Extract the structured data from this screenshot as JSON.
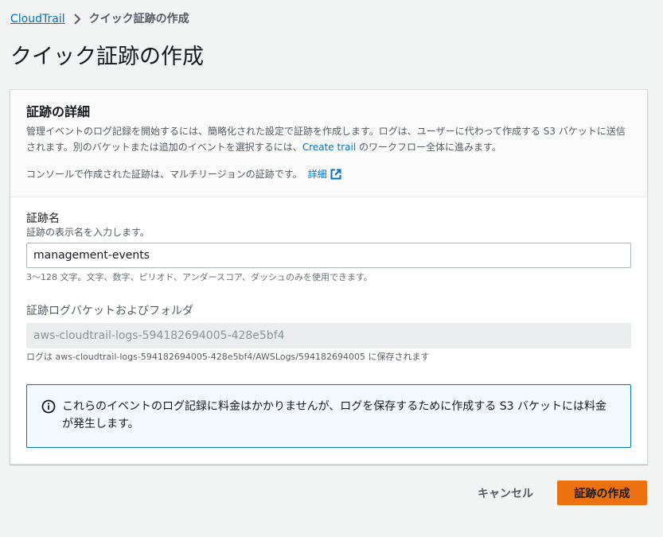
{
  "breadcrumb": {
    "root": "CloudTrail",
    "current": "クイック証跡の作成"
  },
  "page_title": "クイック証跡の作成",
  "details": {
    "heading": "証跡の詳細",
    "description_prefix": "管理イベントのログ記録を開始するには、簡略化された設定で証跡を作成します。ログは、ユーザーに代わって作成する S3 バケットに送信されます。別のバケットまたは追加のイベントを選択するには、",
    "create_trail_link": "Create trail",
    "description_suffix": " のワークフロー全体に進みます。",
    "multiregion_note": "コンソールで作成された証跡は、マルチリージョンの証跡です。",
    "details_link": "詳細"
  },
  "trail_name": {
    "label": "証跡名",
    "description": "証跡の表示名を入力します。",
    "value": "management-events",
    "constraint": "3〜128 文字。文字、数字、ピリオド、アンダースコア、ダッシュのみを使用できます。"
  },
  "bucket": {
    "label": "証跡ログバケットおよびフォルダ",
    "value": "aws-cloudtrail-logs-594182694005-428e5bf4",
    "path_note": "ログは aws-cloudtrail-logs-594182694005-428e5bf4/AWSLogs/594182694005 に保存されます"
  },
  "info": {
    "text": "これらのイベントのログ記録に料金はかかりませんが、ログを保存するために作成する S3 バケットには料金が発生します。"
  },
  "actions": {
    "cancel": "キャンセル",
    "create": "証跡の作成"
  },
  "colors": {
    "link": "#0073bb",
    "primary": "#ec7211",
    "info_border": "#0073bb",
    "info_bg": "#f1faff"
  }
}
